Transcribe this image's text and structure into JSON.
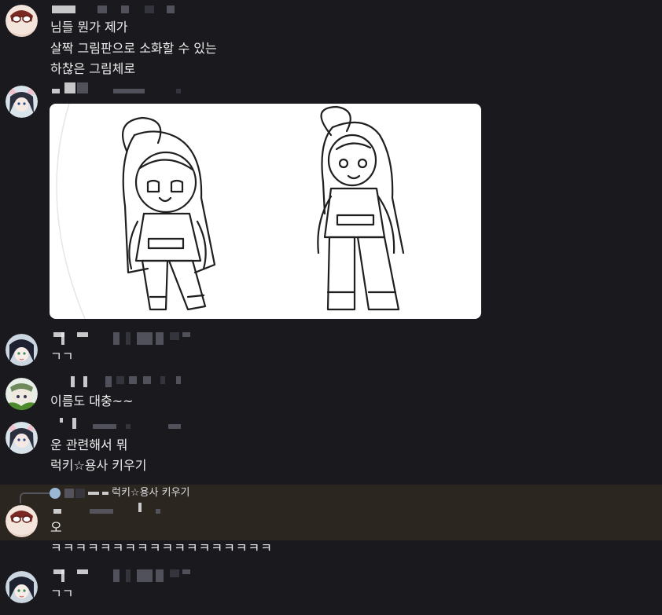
{
  "messages": [
    {
      "lines": [
        "님들 뭔가 제가",
        "살짝 그림판으로 소화할 수 있는",
        "하찮은 그림체로"
      ]
    },
    {
      "attachment": {
        "icon": "drawing-image"
      }
    },
    {
      "lines": [
        "ㄱㄱ"
      ]
    },
    {
      "lines": [
        "이름도 대충~~"
      ]
    },
    {
      "lines": [
        "운 관련해서 뭐",
        "럭키☆용사 키우기"
      ]
    },
    {
      "reply_preview": "럭키☆용사 키우기",
      "lines": [
        "오",
        "ㅋㅋㅋㅋㅋㅋㅋㅋㅋㅋㅋㅋㅋㅋㅋㅋㅋㅋ"
      ]
    },
    {
      "lines": [
        "ㄱㄱ"
      ]
    }
  ],
  "colors": {
    "background": "#1a1a1e",
    "highlight": "#2c2620",
    "text": "#eeeeef"
  }
}
